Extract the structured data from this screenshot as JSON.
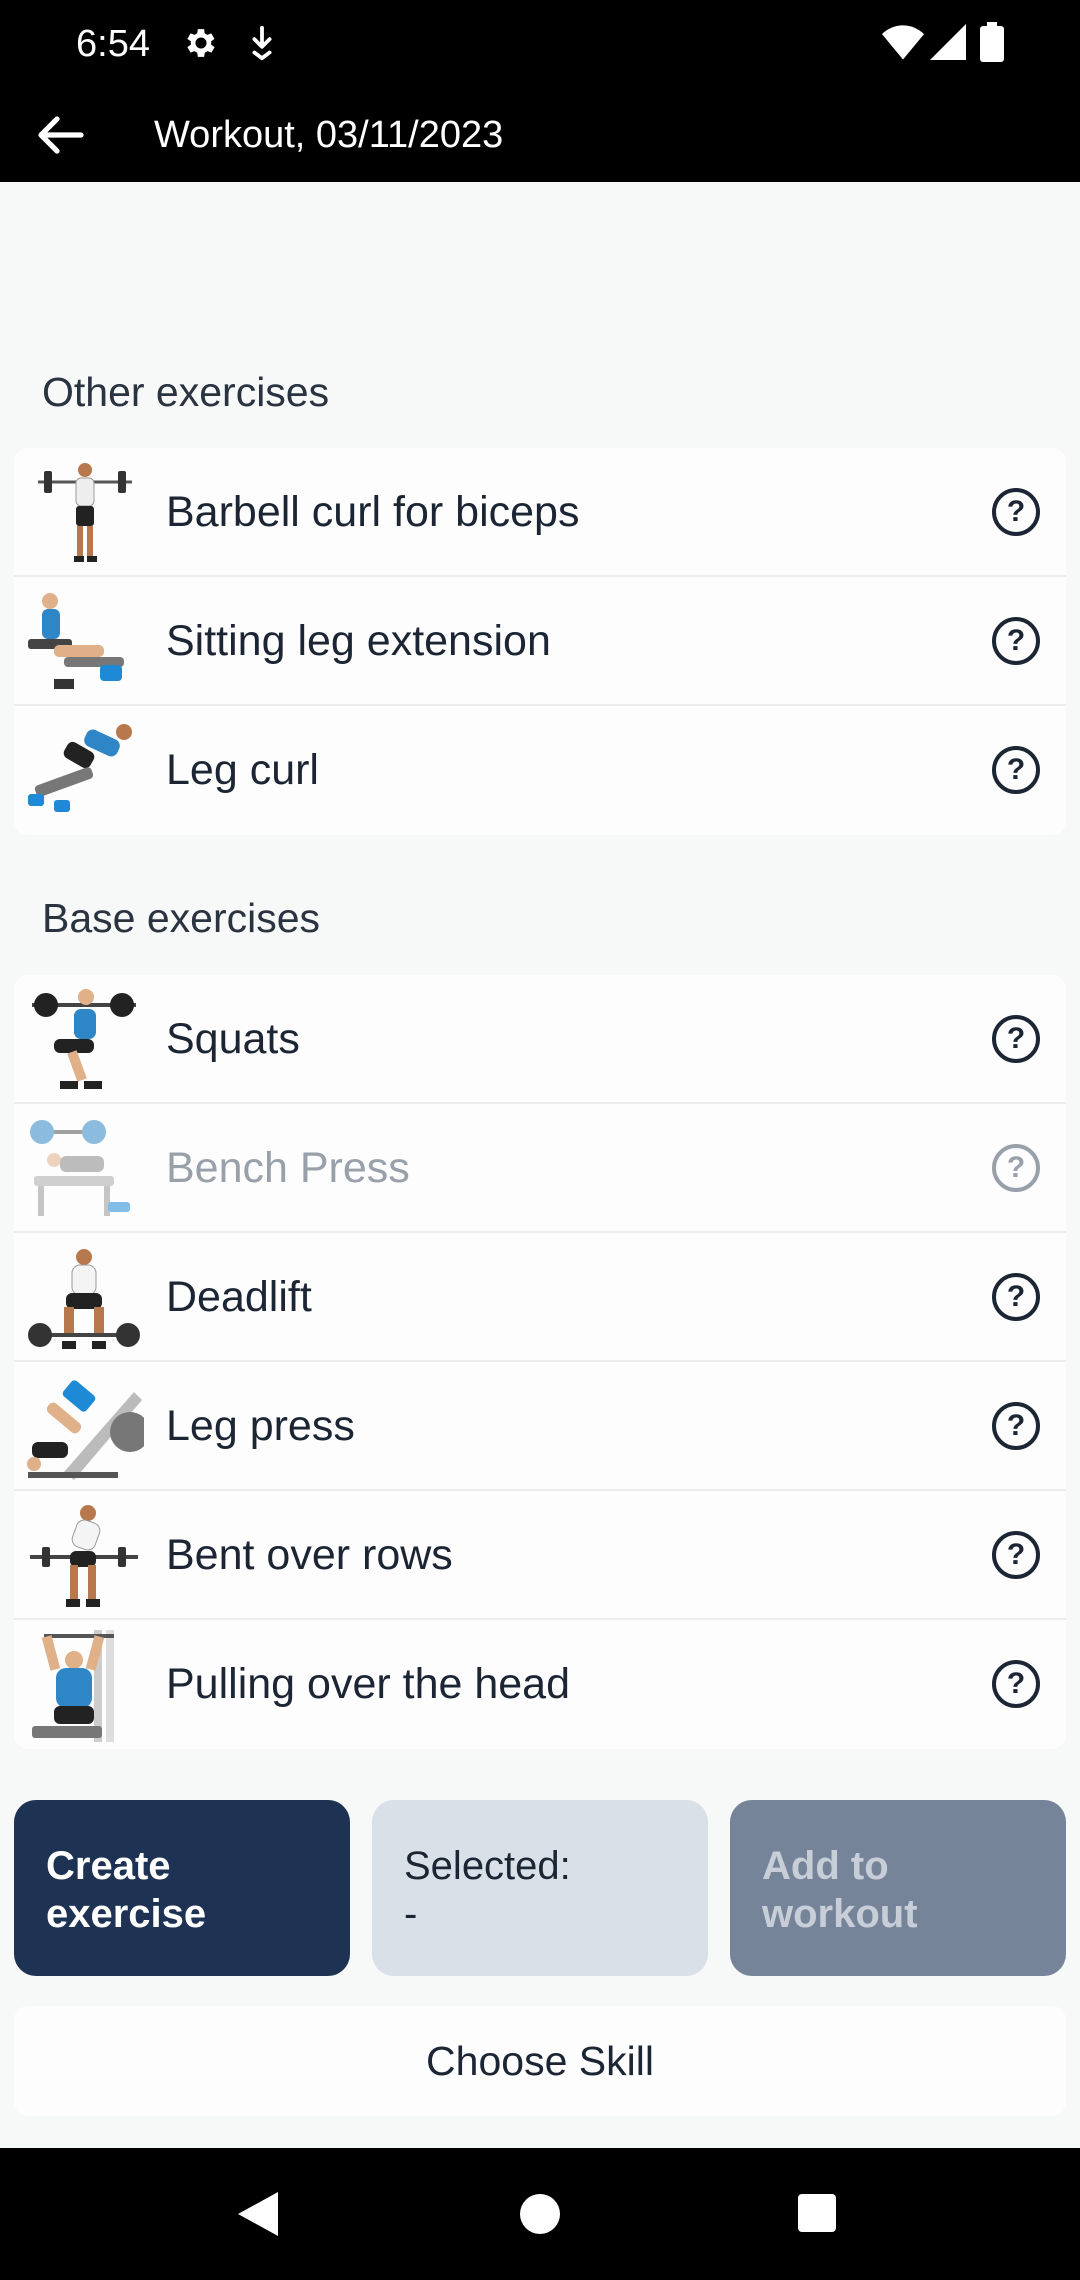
{
  "status_bar": {
    "time": "6:54",
    "icons": [
      "gear-icon",
      "download-icon",
      "wifi-icon",
      "signal-icon",
      "battery-icon"
    ]
  },
  "app_bar": {
    "back_icon": "arrow-left-icon",
    "title": "Workout, 03/11/2023"
  },
  "sections": [
    {
      "title": "Other exercises",
      "items": [
        {
          "label": "Barbell curl for biceps",
          "icon": "barbell-curl-illustration",
          "enabled": true
        },
        {
          "label": "Sitting leg extension",
          "icon": "leg-extension-illustration",
          "enabled": true
        },
        {
          "label": "Leg curl",
          "icon": "leg-curl-illustration",
          "enabled": true
        }
      ]
    },
    {
      "title": "Base exercises",
      "items": [
        {
          "label": "Squats",
          "icon": "squat-illustration",
          "enabled": true
        },
        {
          "label": "Bench Press",
          "icon": "bench-press-illustration",
          "enabled": false
        },
        {
          "label": "Deadlift",
          "icon": "deadlift-illustration",
          "enabled": true
        },
        {
          "label": "Leg press",
          "icon": "leg-press-illustration",
          "enabled": true
        },
        {
          "label": "Bent over rows",
          "icon": "bent-over-row-illustration",
          "enabled": true
        },
        {
          "label": "Pulling over the head",
          "icon": "lat-pulldown-illustration",
          "enabled": true
        }
      ]
    }
  ],
  "help_glyph": "?",
  "actions": {
    "create_line1": "Create",
    "create_line2": "exercise",
    "selected_line1": "Selected:",
    "selected_line2": "-",
    "add_line1": "Add to",
    "add_line2": "workout"
  },
  "choose_skill": "Choose Skill",
  "colors": {
    "app_bar": "#000000",
    "primary_button": "#1e3254",
    "selected_button": "#d9e0e8",
    "disabled_button": "#76849a",
    "background": "#f7f8f8"
  },
  "nav_bar": {
    "icons": [
      "nav-back-icon",
      "nav-home-icon",
      "nav-recents-icon"
    ]
  }
}
